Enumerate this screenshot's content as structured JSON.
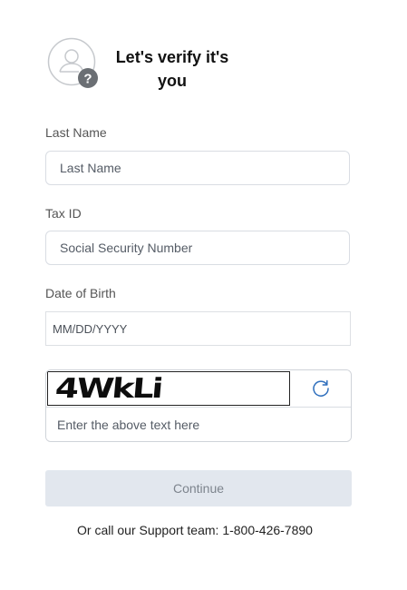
{
  "header": {
    "title": "Let's verify it's you"
  },
  "form": {
    "last_name": {
      "label": "Last Name",
      "placeholder": "Last Name",
      "value": ""
    },
    "tax_id": {
      "label": "Tax ID",
      "placeholder": "Social Security Number",
      "value": ""
    },
    "dob": {
      "label": "Date of Birth",
      "placeholder": "MM/DD/YYYY",
      "value": ""
    },
    "captcha": {
      "image_text": "4WkLi",
      "refresh_icon": "refresh-icon",
      "input_placeholder": "Enter the above text here",
      "input_value": ""
    },
    "continue_label": "Continue"
  },
  "footer": {
    "support_text": "Or call our Support team: 1-800-426-7890"
  },
  "colors": {
    "button_bg": "#e2e7ee",
    "button_text": "#7d848d",
    "border": "#d9dde3",
    "accent": "#2f6fbd"
  }
}
